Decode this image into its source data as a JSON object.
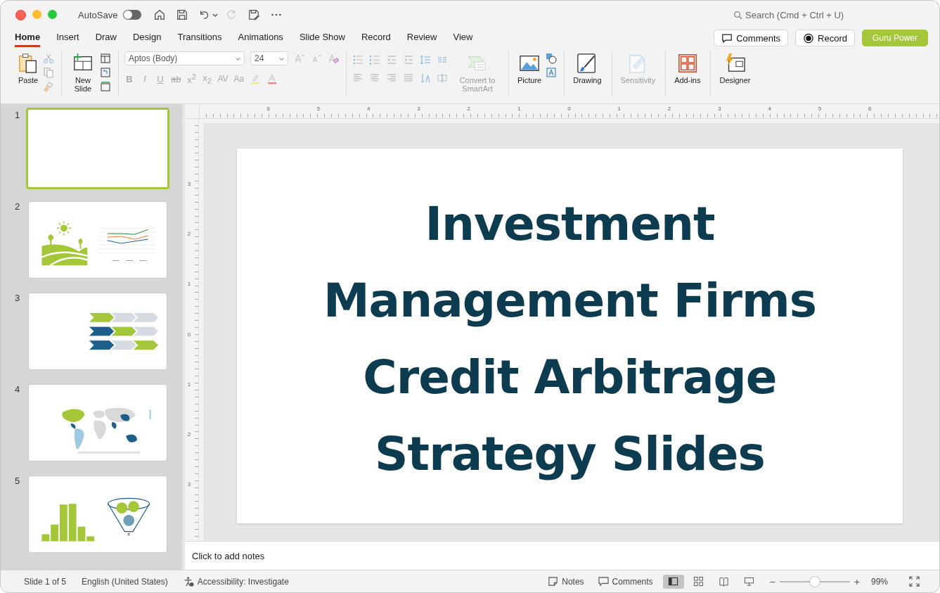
{
  "title_bar": {
    "autosave_label": "AutoSave",
    "autosave_on": false,
    "search_placeholder": "Search (Cmd + Ctrl + U)"
  },
  "tabs": [
    {
      "label": "Home",
      "selected": true
    },
    {
      "label": "Insert",
      "selected": false
    },
    {
      "label": "Draw",
      "selected": false
    },
    {
      "label": "Design",
      "selected": false
    },
    {
      "label": "Transitions",
      "selected": false
    },
    {
      "label": "Animations",
      "selected": false
    },
    {
      "label": "Slide Show",
      "selected": false
    },
    {
      "label": "Record",
      "selected": false
    },
    {
      "label": "Review",
      "selected": false
    },
    {
      "label": "View",
      "selected": false
    }
  ],
  "header_buttons": [
    {
      "kind": "comments",
      "label": "Comments"
    },
    {
      "kind": "record",
      "label": "Record"
    },
    {
      "kind": "premium",
      "label": "Guru Power"
    }
  ],
  "ribbon": [
    {
      "kind": "paste",
      "label": "Paste",
      "disabled": false
    },
    {
      "kind": "new_slide",
      "label": "New Slide",
      "disabled": false
    },
    {
      "kind": "font",
      "font": "Aptos (Body)",
      "size": "24",
      "format_buttons": [
        {
          "kind": "bold",
          "label": "B"
        },
        {
          "kind": "italic",
          "label": "I"
        },
        {
          "kind": "underline",
          "label": "U"
        },
        {
          "kind": "strike",
          "label": "ab"
        },
        {
          "kind": "script",
          "label": "x$^{2}$"
        },
        {
          "kind": "script",
          "label": "x$_{2}$"
        },
        {
          "kind": "plain",
          "label": "AV"
        },
        {
          "kind": "plain",
          "label": "Aa"
        }
      ]
    },
    {
      "kind": "paragraph",
      "label": "Convert to SmartArt",
      "disabled": true
    },
    {
      "kind": "picture",
      "label": "Picture",
      "disabled": false
    },
    {
      "kind": "drawing",
      "label": "Drawing",
      "disabled": false
    },
    {
      "kind": "sensitivity",
      "label": "Sensitivity",
      "disabled": true
    },
    {
      "kind": "addins",
      "label": "Add-ins",
      "disabled": false
    },
    {
      "kind": "designer",
      "label": "Designer",
      "disabled": false
    }
  ],
  "slides": [
    {
      "number": "1",
      "kind": "blank",
      "selected": true
    },
    {
      "number": "2",
      "kind": "landscape_chart",
      "selected": false
    },
    {
      "number": "3",
      "kind": "chevrons",
      "selected": false
    },
    {
      "number": "4",
      "kind": "map",
      "selected": false
    },
    {
      "number": "5",
      "kind": "histogram_funnel",
      "selected": false
    }
  ],
  "ruler": {
    "horizontal": [
      "6",
      "5",
      "4",
      "3",
      "2",
      "1",
      "0",
      "1",
      "2",
      "3",
      "4",
      "5",
      "6"
    ],
    "vertical": [
      "3",
      "2",
      "1",
      "0",
      "1",
      "2",
      "3"
    ]
  },
  "slide": {
    "title_lines": [
      "Investment",
      "Management Firms",
      "Credit Arbitrage",
      "Strategy Slides"
    ]
  },
  "notes": {
    "placeholder": "Click to add notes"
  },
  "status_bar": {
    "slide_position": "Slide 1 of 5",
    "language": "English (United States)",
    "accessibility": "Accessibility: Investigate",
    "notes_label": "Notes",
    "comments_label": "Comments",
    "views": [
      {
        "kind": "normal",
        "selected": true
      },
      {
        "kind": "sorter",
        "selected": false
      },
      {
        "kind": "reading",
        "selected": false
      },
      {
        "kind": "presenter",
        "selected": false
      }
    ],
    "zoom": {
      "out_label": "−",
      "level": 0.5,
      "in_label": "+",
      "reading": "99%"
    }
  }
}
